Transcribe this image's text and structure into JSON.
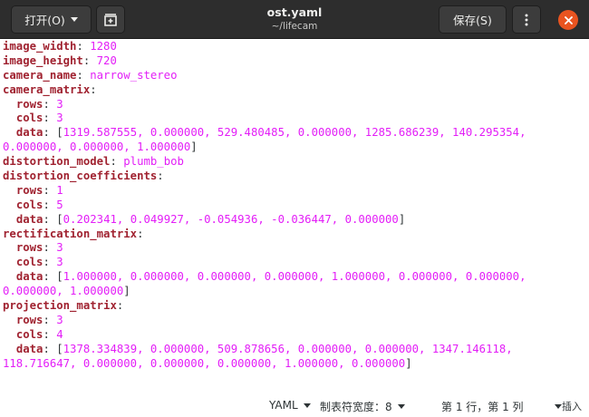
{
  "header": {
    "open_label": "打开(O)",
    "save_label": "保存(S)",
    "title": "ost.yaml",
    "subtitle": "~/lifecam",
    "icons": {
      "new_tab": "new-tab-icon",
      "menu": "kebab-menu-icon",
      "close": "close-icon"
    },
    "colors": {
      "close_button": "#e95420",
      "header_bg": "#2d2d2d"
    }
  },
  "editor": {
    "colors": {
      "key": "#a02230",
      "value": "#e31ef7",
      "punct": "#2e3436"
    },
    "lines": [
      {
        "indent": "",
        "key": "image_width",
        "sep": ": ",
        "value": "1280"
      },
      {
        "indent": "",
        "key": "image_height",
        "sep": ": ",
        "value": "720"
      },
      {
        "indent": "",
        "key": "camera_name",
        "sep": ": ",
        "value": "narrow_stereo"
      },
      {
        "indent": "",
        "key": "camera_matrix",
        "sep": ":",
        "value": ""
      },
      {
        "indent": "  ",
        "key": "rows",
        "sep": ": ",
        "value": "3"
      },
      {
        "indent": "  ",
        "key": "cols",
        "sep": ": ",
        "value": "3"
      },
      {
        "indent": "  ",
        "key": "data",
        "sep": ": ",
        "open": "[",
        "value": "1319.587555, 0.000000, 529.480485, 0.000000, 1285.686239, 140.295354,"
      },
      {
        "indent": "",
        "key": "",
        "sep": "",
        "value": "0.000000, 0.000000, 1.000000",
        "close": "]"
      },
      {
        "indent": "",
        "key": "distortion_model",
        "sep": ": ",
        "value": "plumb_bob"
      },
      {
        "indent": "",
        "key": "distortion_coefficients",
        "sep": ":",
        "value": ""
      },
      {
        "indent": "  ",
        "key": "rows",
        "sep": ": ",
        "value": "1"
      },
      {
        "indent": "  ",
        "key": "cols",
        "sep": ": ",
        "value": "5"
      },
      {
        "indent": "  ",
        "key": "data",
        "sep": ": ",
        "open": "[",
        "value": "0.202341, 0.049927, -0.054936, -0.036447, 0.000000",
        "close": "]"
      },
      {
        "indent": "",
        "key": "rectification_matrix",
        "sep": ":",
        "value": ""
      },
      {
        "indent": "  ",
        "key": "rows",
        "sep": ": ",
        "value": "3"
      },
      {
        "indent": "  ",
        "key": "cols",
        "sep": ": ",
        "value": "3"
      },
      {
        "indent": "  ",
        "key": "data",
        "sep": ": ",
        "open": "[",
        "value": "1.000000, 0.000000, 0.000000, 0.000000, 1.000000, 0.000000, 0.000000,"
      },
      {
        "indent": "",
        "key": "",
        "sep": "",
        "value": "0.000000, 1.000000",
        "close": "]"
      },
      {
        "indent": "",
        "key": "projection_matrix",
        "sep": ":",
        "value": ""
      },
      {
        "indent": "  ",
        "key": "rows",
        "sep": ": ",
        "value": "3"
      },
      {
        "indent": "  ",
        "key": "cols",
        "sep": ": ",
        "value": "4"
      },
      {
        "indent": "  ",
        "key": "data",
        "sep": ": ",
        "open": "[",
        "value": "1378.334839, 0.000000, 509.878656, 0.000000, 0.000000, 1347.146118,"
      },
      {
        "indent": "",
        "key": "",
        "sep": "",
        "value": "118.716647, 0.000000, 0.000000, 0.000000, 1.000000, 0.000000",
        "close": "]"
      }
    ]
  },
  "statusbar": {
    "language": "YAML",
    "tab_width": "制表符宽度：8",
    "position": "第 1 行，第 1 列",
    "mode": "插入"
  }
}
